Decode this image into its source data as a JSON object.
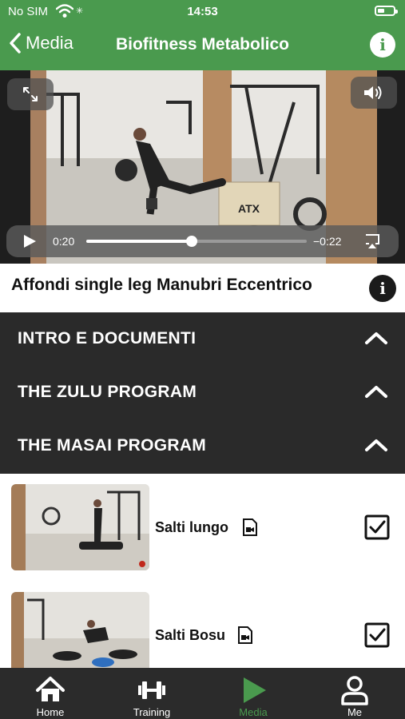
{
  "status_bar": {
    "carrier": "No SIM",
    "time": "14:53"
  },
  "nav": {
    "back_label": "Media",
    "title": "Biofitness Metabolico"
  },
  "video": {
    "current_time": "0:20",
    "remaining_time": "−0:22",
    "progress": 0.48,
    "box_brand": "ATX"
  },
  "exercise": {
    "title": "Affondi single leg Manubri Eccentrico"
  },
  "sections": [
    {
      "label": "INTRO E DOCUMENTI",
      "expanded": true
    },
    {
      "label": "THE ZULU PROGRAM",
      "expanded": true
    },
    {
      "label": "THE MASAI PROGRAM",
      "expanded": true
    }
  ],
  "items": [
    {
      "name": "Salti lungo",
      "checked": true
    },
    {
      "name": "Salti Bosu",
      "checked": true
    }
  ],
  "tabs": [
    {
      "label": "Home",
      "icon": "home-icon",
      "active": false
    },
    {
      "label": "Training",
      "icon": "dumbbell-icon",
      "active": false
    },
    {
      "label": "Media",
      "icon": "play-icon",
      "active": true
    },
    {
      "label": "Me",
      "icon": "person-icon",
      "active": false
    }
  ],
  "colors": {
    "brand_green": "#4a9a4e",
    "dark_section": "#2a2a2a",
    "tab_bar": "#2b2b2b"
  }
}
